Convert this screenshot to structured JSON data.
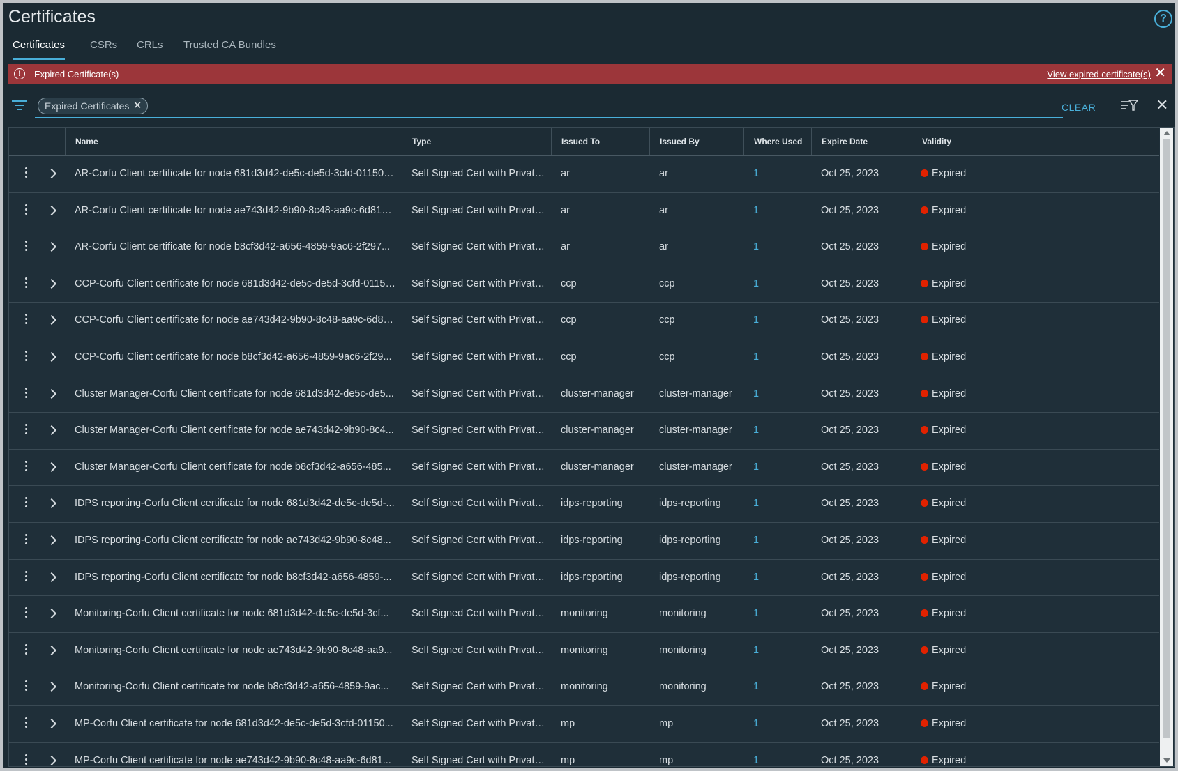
{
  "page": {
    "title": "Certificates"
  },
  "tabs": [
    {
      "label": "Certificates",
      "active": true
    },
    {
      "label": "CSRs",
      "active": false
    },
    {
      "label": "CRLs",
      "active": false
    },
    {
      "label": "Trusted CA Bundles",
      "active": false
    }
  ],
  "alert": {
    "text": "Expired Certificate(s)",
    "link": "View expired certificate(s)"
  },
  "filter": {
    "chip": "Expired Certificates",
    "clear_label": "CLEAR"
  },
  "grid": {
    "columns": [
      "Name",
      "Type",
      "Issued To",
      "Issued By",
      "Where Used",
      "Expire Date",
      "Validity"
    ],
    "rows": [
      {
        "name": "AR-Corfu Client certificate for node 681d3d42-de5c-de5d-3cfd-011503...",
        "type": "Self Signed Cert with Private...",
        "issued_to": "ar",
        "issued_by": "ar",
        "where_used": "1",
        "expire": "Oct 25, 2023",
        "validity": "Expired"
      },
      {
        "name": "AR-Corfu Client certificate for node ae743d42-9b90-8c48-aa9c-6d816...",
        "type": "Self Signed Cert with Private...",
        "issued_to": "ar",
        "issued_by": "ar",
        "where_used": "1",
        "expire": "Oct 25, 2023",
        "validity": "Expired"
      },
      {
        "name": "AR-Corfu Client certificate for node b8cf3d42-a656-4859-9ac6-2f297...",
        "type": "Self Signed Cert with Private...",
        "issued_to": "ar",
        "issued_by": "ar",
        "where_used": "1",
        "expire": "Oct 25, 2023",
        "validity": "Expired"
      },
      {
        "name": "CCP-Corfu Client certificate for node 681d3d42-de5c-de5d-3cfd-01150...",
        "type": "Self Signed Cert with Private...",
        "issued_to": "ccp",
        "issued_by": "ccp",
        "where_used": "1",
        "expire": "Oct 25, 2023",
        "validity": "Expired"
      },
      {
        "name": "CCP-Corfu Client certificate for node ae743d42-9b90-8c48-aa9c-6d81...",
        "type": "Self Signed Cert with Private...",
        "issued_to": "ccp",
        "issued_by": "ccp",
        "where_used": "1",
        "expire": "Oct 25, 2023",
        "validity": "Expired"
      },
      {
        "name": "CCP-Corfu Client certificate for node b8cf3d42-a656-4859-9ac6-2f29...",
        "type": "Self Signed Cert with Private...",
        "issued_to": "ccp",
        "issued_by": "ccp",
        "where_used": "1",
        "expire": "Oct 25, 2023",
        "validity": "Expired"
      },
      {
        "name": "Cluster Manager-Corfu Client certificate for node 681d3d42-de5c-de5...",
        "type": "Self Signed Cert with Private...",
        "issued_to": "cluster-manager",
        "issued_by": "cluster-manager",
        "where_used": "1",
        "expire": "Oct 25, 2023",
        "validity": "Expired"
      },
      {
        "name": "Cluster Manager-Corfu Client certificate for node ae743d42-9b90-8c4...",
        "type": "Self Signed Cert with Private...",
        "issued_to": "cluster-manager",
        "issued_by": "cluster-manager",
        "where_used": "1",
        "expire": "Oct 25, 2023",
        "validity": "Expired"
      },
      {
        "name": "Cluster Manager-Corfu Client certificate for node b8cf3d42-a656-485...",
        "type": "Self Signed Cert with Private...",
        "issued_to": "cluster-manager",
        "issued_by": "cluster-manager",
        "where_used": "1",
        "expire": "Oct 25, 2023",
        "validity": "Expired"
      },
      {
        "name": "IDPS reporting-Corfu Client certificate for node 681d3d42-de5c-de5d-...",
        "type": "Self Signed Cert with Private...",
        "issued_to": "idps-reporting",
        "issued_by": "idps-reporting",
        "where_used": "1",
        "expire": "Oct 25, 2023",
        "validity": "Expired"
      },
      {
        "name": "IDPS reporting-Corfu Client certificate for node ae743d42-9b90-8c48...",
        "type": "Self Signed Cert with Private...",
        "issued_to": "idps-reporting",
        "issued_by": "idps-reporting",
        "where_used": "1",
        "expire": "Oct 25, 2023",
        "validity": "Expired"
      },
      {
        "name": "IDPS reporting-Corfu Client certificate for node b8cf3d42-a656-4859-...",
        "type": "Self Signed Cert with Private...",
        "issued_to": "idps-reporting",
        "issued_by": "idps-reporting",
        "where_used": "1",
        "expire": "Oct 25, 2023",
        "validity": "Expired"
      },
      {
        "name": "Monitoring-Corfu Client certificate for node 681d3d42-de5c-de5d-3cf...",
        "type": "Self Signed Cert with Private...",
        "issued_to": "monitoring",
        "issued_by": "monitoring",
        "where_used": "1",
        "expire": "Oct 25, 2023",
        "validity": "Expired"
      },
      {
        "name": "Monitoring-Corfu Client certificate for node ae743d42-9b90-8c48-aa9...",
        "type": "Self Signed Cert with Private...",
        "issued_to": "monitoring",
        "issued_by": "monitoring",
        "where_used": "1",
        "expire": "Oct 25, 2023",
        "validity": "Expired"
      },
      {
        "name": "Monitoring-Corfu Client certificate for node b8cf3d42-a656-4859-9ac...",
        "type": "Self Signed Cert with Private...",
        "issued_to": "monitoring",
        "issued_by": "monitoring",
        "where_used": "1",
        "expire": "Oct 25, 2023",
        "validity": "Expired"
      },
      {
        "name": "MP-Corfu Client certificate for node 681d3d42-de5c-de5d-3cfd-01150...",
        "type": "Self Signed Cert with Private...",
        "issued_to": "mp",
        "issued_by": "mp",
        "where_used": "1",
        "expire": "Oct 25, 2023",
        "validity": "Expired"
      },
      {
        "name": "MP-Corfu Client certificate for node ae743d42-9b90-8c48-aa9c-6d81...",
        "type": "Self Signed Cert with Private...",
        "issued_to": "mp",
        "issued_by": "mp",
        "where_used": "1",
        "expire": "Oct 25, 2023",
        "validity": "Expired"
      }
    ]
  },
  "icons": {
    "help": "help-circle-icon",
    "alert": "error-circle-icon",
    "filter": "filter-lines-icon",
    "sort": "filter-sort-icon",
    "close": "close-icon",
    "row_actions": "kebab-menu-icon",
    "expand": "chevron-right-icon",
    "status": "red-dot-icon"
  },
  "colors": {
    "background": "#1b2a33",
    "accent": "#49afd9",
    "alert": "#9c363a",
    "expired": "#e12200"
  }
}
